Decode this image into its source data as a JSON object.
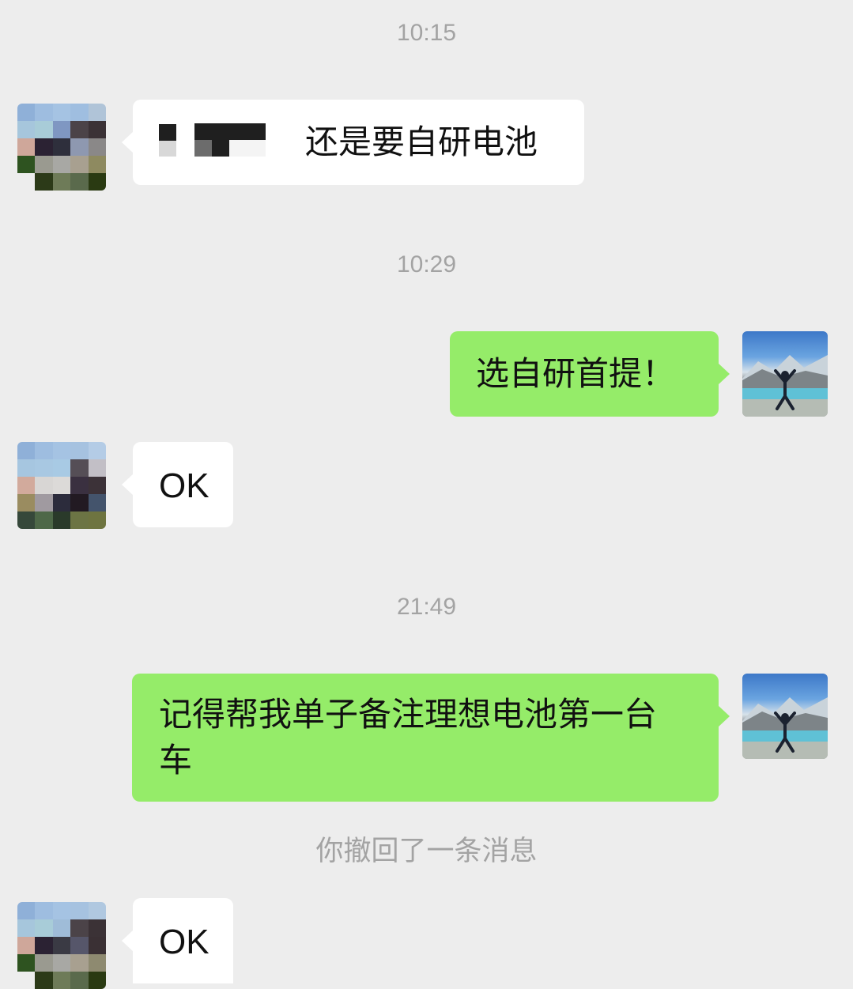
{
  "chat": {
    "messages": [
      {
        "kind": "time",
        "text": "10:15"
      },
      {
        "kind": "incoming",
        "text": "还是要自研电池",
        "redacted": true
      },
      {
        "kind": "time",
        "text": "10:29"
      },
      {
        "kind": "outgoing",
        "text": "选自研首提！"
      },
      {
        "kind": "incoming",
        "text": "OK"
      },
      {
        "kind": "time",
        "text": "21:49"
      },
      {
        "kind": "outgoing",
        "line1": "记得帮我单子备注理想电池第一台",
        "line2": "车"
      },
      {
        "kind": "system",
        "text": "你撤回了一条消息"
      },
      {
        "kind": "incoming",
        "text": "OK"
      }
    ]
  },
  "colors": {
    "background": "#ededed",
    "incoming_bubble": "#ffffff",
    "outgoing_bubble": "#95ec69",
    "timestamp": "#a3a3a3"
  },
  "icons": {
    "contact_avatar": "pixelated-avatar-icon",
    "self_avatar": "mountain-lake-photo-avatar-icon"
  }
}
